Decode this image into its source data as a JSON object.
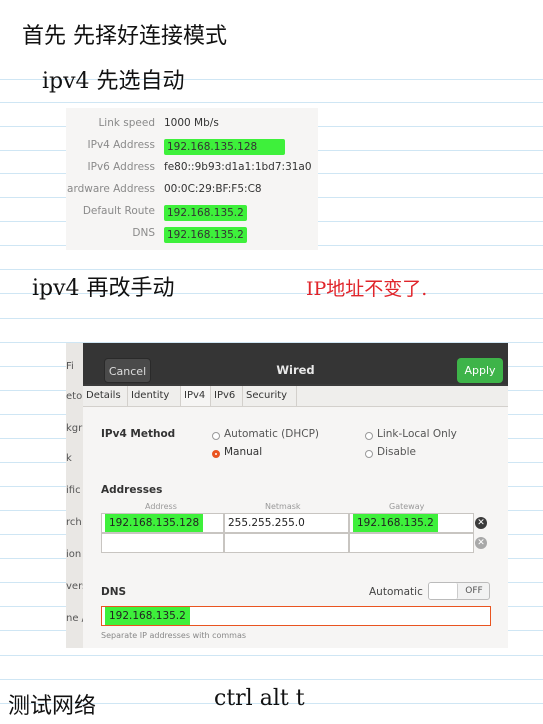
{
  "notes": {
    "line1": "首先 先择好连接模式",
    "line2": "ipv4  先选自动",
    "line3": "ipv4  再改手动",
    "line3_red": "IP地址不变了.",
    "line4": "测试网络",
    "line4_keys": "ctrl  alt  t"
  },
  "details": {
    "rows": [
      {
        "key": "Link speed",
        "value": "1000 Mb/s",
        "highlight": false
      },
      {
        "key": "IPv4 Address",
        "value": "192.168.135.128",
        "highlight": true
      },
      {
        "key": "IPv6 Address",
        "value": "fe80::9b93:d1a1:1bd7:31a0",
        "highlight": false
      },
      {
        "key": "ardware Address",
        "value": "00:0C:29:BF:F5:C8",
        "highlight": false
      },
      {
        "key": "Default Route",
        "value": "192.168.135.2",
        "highlight": true
      },
      {
        "key": "DNS",
        "value": "192.168.135.2",
        "highlight": true
      }
    ]
  },
  "dialog": {
    "title": "Wired",
    "cancel_label": "Cancel",
    "apply_label": "Apply",
    "left_strip": [
      "Fi",
      "eto",
      "kgr",
      "k",
      "ific",
      "rch",
      "ion",
      "vers",
      "ne /"
    ],
    "tabs": [
      "Details",
      "Identity",
      "IPv4",
      "IPv6",
      "Security"
    ],
    "ipv4_method_label": "IPv4 Method",
    "methods": {
      "automatic": "Automatic (DHCP)",
      "link_local": "Link-Local Only",
      "manual": "Manual",
      "disable": "Disable",
      "selected": "manual"
    },
    "addresses_label": "Addresses",
    "columns": [
      "Address",
      "Netmask",
      "Gateway"
    ],
    "address_rows": [
      {
        "address": "192.168.135.128",
        "netmask": "255.255.255.0",
        "gateway": "192.168.135.2"
      },
      {
        "address": "",
        "netmask": "",
        "gateway": ""
      }
    ],
    "dns_label": "DNS",
    "automatic_label": "Automatic",
    "toggle_state": "OFF",
    "dns_value": "192.168.135.2",
    "dns_hint": "Separate IP addresses with commas"
  },
  "colors": {
    "highlight": "#3ef03b",
    "apply": "#3eb449",
    "accent": "#e95420",
    "handwriting_red": "#e0252b"
  }
}
